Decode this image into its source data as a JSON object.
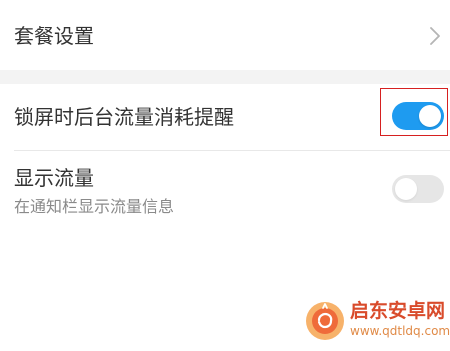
{
  "settings": {
    "package_settings": {
      "label": "套餐设置"
    },
    "lockscreen_background_alert": {
      "label": "锁屏时后台流量消耗提醒",
      "enabled": true
    },
    "show_traffic": {
      "label": "显示流量",
      "sublabel": "在通知栏显示流量信息",
      "enabled": false
    }
  },
  "icons": {
    "chevron": "chevron-right-icon",
    "toggle_on": "toggle-on-icon",
    "toggle_off": "toggle-off-icon",
    "watermark": "brand-logo-icon"
  },
  "colors": {
    "accent": "#1e9bf0",
    "toggle_off": "#e6e6e6",
    "highlight_border": "#d62020",
    "watermark_primary": "#d94b2b",
    "watermark_secondary": "#e08a47",
    "text_primary": "#333333",
    "text_secondary": "#8a8a8a"
  },
  "watermark": {
    "title": "启东安卓网",
    "url": "www.qdtldq.com"
  }
}
